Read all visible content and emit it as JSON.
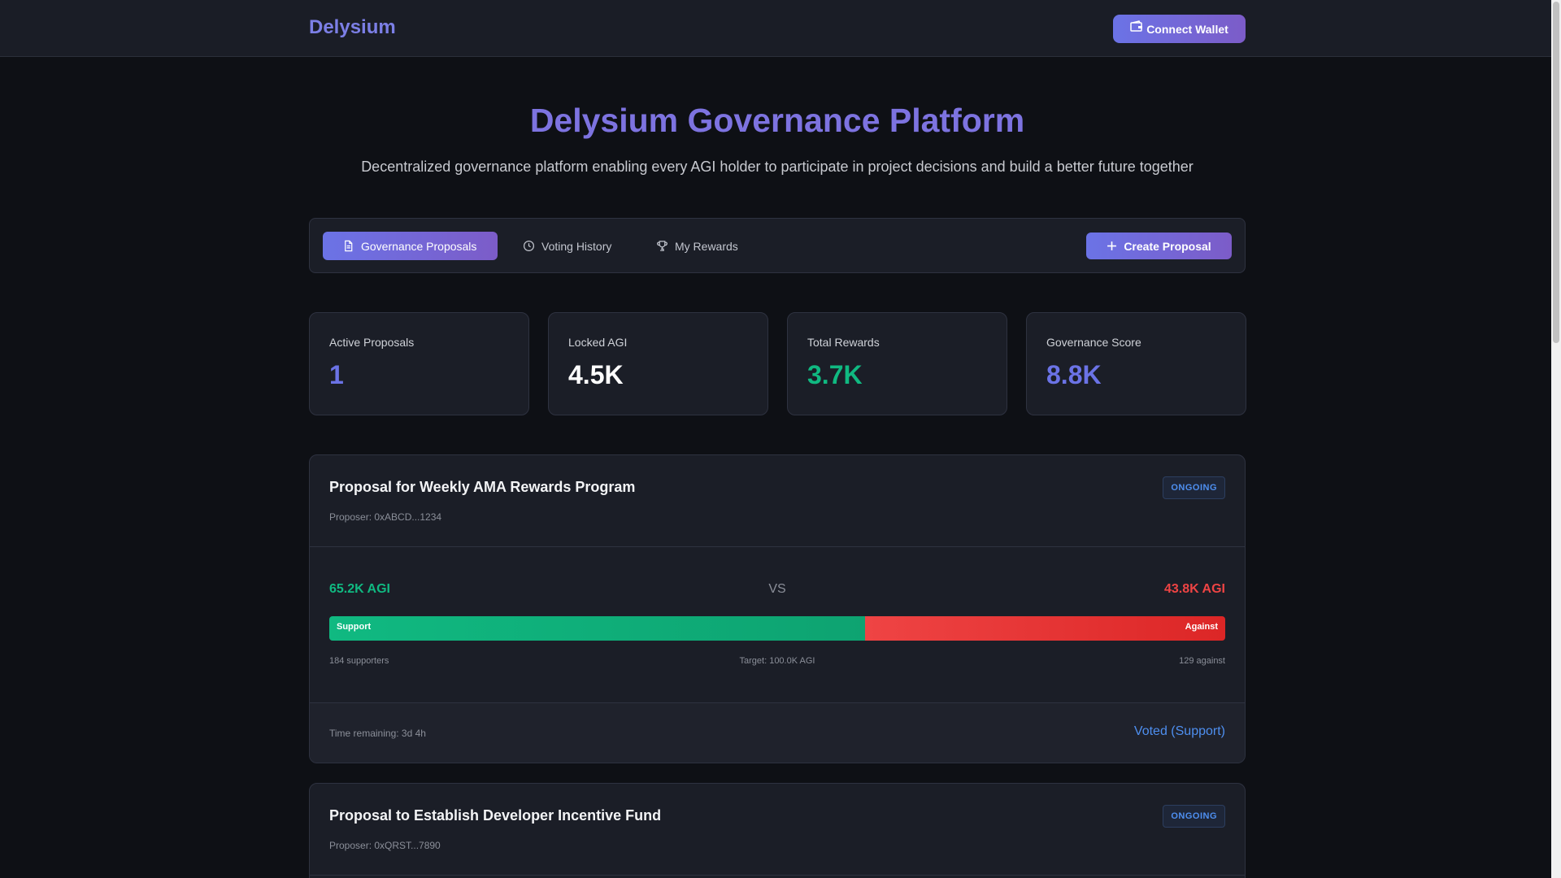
{
  "header": {
    "brand": "Delysium",
    "connect_label": "Connect Wallet"
  },
  "hero": {
    "title": "Delysium Governance Platform",
    "subtitle": "Decentralized governance platform enabling every AGI holder to participate in project decisions and build a better future together"
  },
  "tabs": [
    {
      "label": "Governance Proposals",
      "icon": "document-icon",
      "active": true
    },
    {
      "label": "Voting History",
      "icon": "clock-icon",
      "active": false
    },
    {
      "label": "My Rewards",
      "icon": "trophy-icon",
      "active": false
    }
  ],
  "create_label": "Create Proposal",
  "stats": [
    {
      "label": "Active Proposals",
      "value": "1",
      "color": "#6b73e6"
    },
    {
      "label": "Locked AGI",
      "value": "4.5K",
      "color": "#ffffff"
    },
    {
      "label": "Total Rewards",
      "value": "3.7K",
      "color": "#10b981"
    },
    {
      "label": "Governance Score",
      "value": "8.8K",
      "color": "#6b73e6"
    }
  ],
  "proposals": [
    {
      "title": "Proposal for Weekly AMA Rewards Program",
      "proposer": "Proposer: 0xABCD...1234",
      "status": "ONGOING",
      "support_amount": "65.2K AGI",
      "vs": "VS",
      "against_amount": "43.8K AGI",
      "support_share": 0.598,
      "support_label": "Support",
      "against_label": "Against",
      "supporters": "184 supporters",
      "target": "Target: 100.0K AGI",
      "against_count": "129 against",
      "time_remaining": "Time remaining: 3d 4h",
      "vote_status": "Voted (Support)"
    },
    {
      "title": "Proposal to Establish Developer Incentive Fund",
      "proposer": "Proposer: 0xQRST...7890",
      "status": "ONGOING"
    }
  ],
  "colors": {
    "accent": "#6b73e6",
    "support": "#10b981",
    "against": "#ef4444",
    "link": "#4e8ff0"
  }
}
